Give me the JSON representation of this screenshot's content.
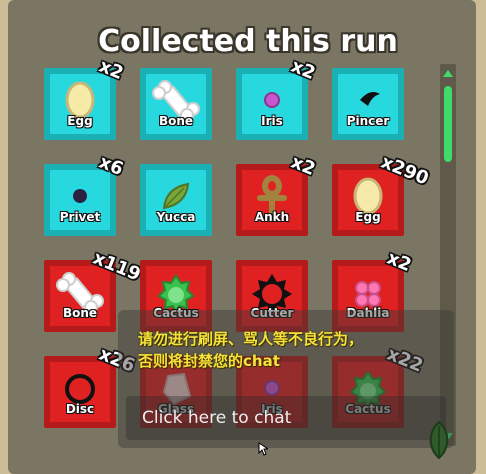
{
  "title": "Collected this run",
  "items": [
    {
      "name": "Egg",
      "count": "x2",
      "rarity": "cyan",
      "icon": "egg-icon"
    },
    {
      "name": "Bone",
      "count": "",
      "rarity": "cyan",
      "icon": "bone-icon"
    },
    {
      "name": "Iris",
      "count": "x2",
      "rarity": "cyan",
      "icon": "iris-icon"
    },
    {
      "name": "Pincer",
      "count": "",
      "rarity": "cyan",
      "icon": "pincer-icon"
    },
    {
      "name": "Privet",
      "count": "x6",
      "rarity": "cyan",
      "icon": "privet-icon"
    },
    {
      "name": "Yucca",
      "count": "",
      "rarity": "cyan",
      "icon": "yucca-icon"
    },
    {
      "name": "Ankh",
      "count": "x2",
      "rarity": "red",
      "icon": "ankh-icon"
    },
    {
      "name": "Egg",
      "count": "x290",
      "rarity": "red",
      "icon": "egg-icon"
    },
    {
      "name": "Bone",
      "count": "x119",
      "rarity": "red",
      "icon": "bone-icon"
    },
    {
      "name": "Cactus",
      "count": "",
      "rarity": "red",
      "icon": "cactus-icon"
    },
    {
      "name": "Cutter",
      "count": "",
      "rarity": "red",
      "icon": "cutter-icon"
    },
    {
      "name": "Dahlia",
      "count": "x2",
      "rarity": "red",
      "icon": "dahlia-icon"
    },
    {
      "name": "Disc",
      "count": "x26",
      "rarity": "red",
      "icon": "disc-icon"
    },
    {
      "name": "Glass",
      "count": "",
      "rarity": "red",
      "icon": "glass-icon"
    },
    {
      "name": "Iris",
      "count": "",
      "rarity": "red",
      "icon": "iris-icon"
    },
    {
      "name": "Cactus",
      "count": "x22",
      "rarity": "red",
      "icon": "cactus-icon"
    }
  ],
  "chat": {
    "warning_line1": "请勿进行刷屏、骂人等不良行为，",
    "warning_line2": "否则将封禁您的chat",
    "placeholder": "Click here to chat"
  },
  "colors": {
    "common_tile": "#27d9de",
    "rare_tile": "#e02121",
    "scrollbar": "#3fdc6c",
    "warning_text": "#f6e23a"
  }
}
